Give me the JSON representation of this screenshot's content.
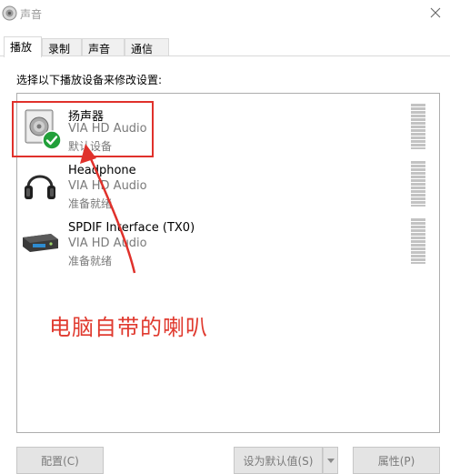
{
  "window": {
    "title": "声音"
  },
  "tabs": [
    {
      "label": "播放",
      "active": true
    },
    {
      "label": "录制",
      "active": false
    },
    {
      "label": "声音",
      "active": false
    },
    {
      "label": "通信",
      "active": false
    }
  ],
  "instruction": "选择以下播放设备来修改设置:",
  "devices": [
    {
      "name": "扬声器",
      "driver": "VIA HD Audio",
      "status": "默认设备",
      "icon": "speaker-icon",
      "default": true
    },
    {
      "name": "Headphone",
      "driver": "VIA HD Audio",
      "status": "准备就绪",
      "icon": "headphone-icon",
      "default": false
    },
    {
      "name": "SPDIF Interface (TX0)",
      "driver": "VIA HD Audio",
      "status": "准备就绪",
      "icon": "spdif-device-icon",
      "default": false
    }
  ],
  "annotation": {
    "text": "电脑自带的喇叭",
    "color": "#e03a2f"
  },
  "buttons": {
    "configure": "配置(C)",
    "set_default": "设为默认值(S)",
    "properties": "属性(P)"
  },
  "colors": {
    "accent_red": "#e0312b",
    "check_green": "#22a03a"
  }
}
